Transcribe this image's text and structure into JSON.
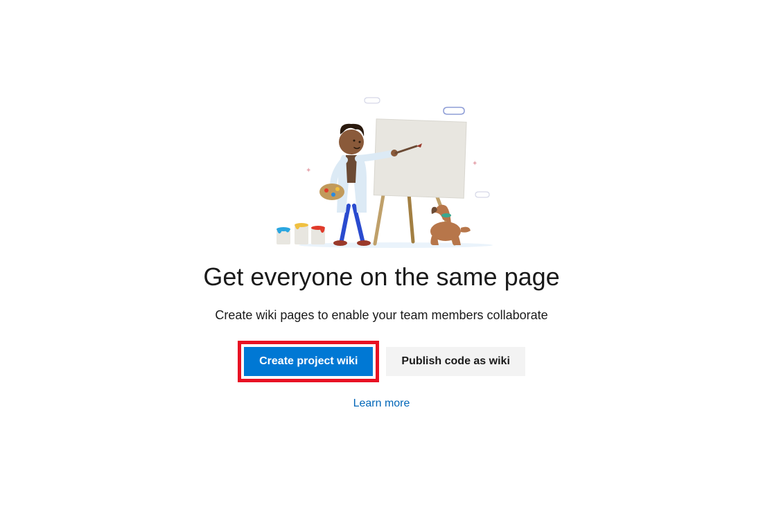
{
  "heading": "Get everyone on the same page",
  "subtitle": "Create wiki pages to enable your team members collaborate",
  "buttons": {
    "primary": "Create project wiki",
    "secondary": "Publish code as wiki"
  },
  "link": "Learn more",
  "highlighted_button": "primary"
}
